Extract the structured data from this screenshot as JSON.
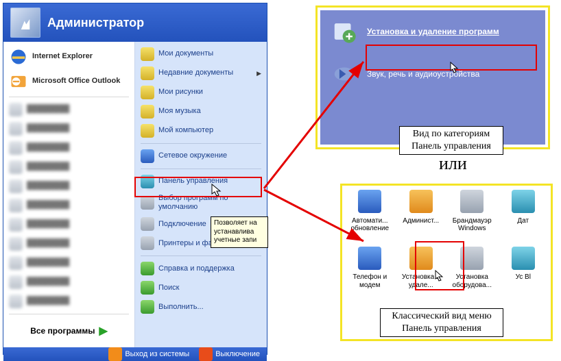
{
  "header": {
    "user": "Администратор"
  },
  "pinned": [
    {
      "label": "Internet Explorer"
    },
    {
      "label": "Microsoft Office Outlook"
    }
  ],
  "recent_blurred_count": 11,
  "all_programs": "Все программы",
  "right_items": [
    {
      "label": "Мои документы",
      "arrow": false
    },
    {
      "label": "Недавние документы",
      "arrow": true
    },
    {
      "label": "Мои рисунки",
      "arrow": false
    },
    {
      "label": "Моя музыка",
      "arrow": false
    },
    {
      "label": "Мой компьютер",
      "arrow": false
    }
  ],
  "right_items2": [
    {
      "label": "Сетевое окружение"
    }
  ],
  "control_panel": "Панель управления",
  "right_items3": [
    {
      "label": "Выбор программ по умолчанию"
    },
    {
      "label": "Подключение",
      "arrow": true
    },
    {
      "label": "Принтеры и факсы"
    }
  ],
  "right_items4": [
    {
      "label": "Справка и поддержка"
    },
    {
      "label": "Поиск"
    },
    {
      "label": "Выполнить..."
    }
  ],
  "footer": {
    "logoff": "Выход из системы",
    "shutdown": "Выключение"
  },
  "tooltip": "Позволяет на устанавлива учетные запи",
  "category_view": {
    "items": [
      {
        "label": "Установка и удаление программ"
      },
      {
        "label": "Звук, речь и аудиоустройства"
      }
    ],
    "caption_line1": "Вид по категориям",
    "caption_line2": "Панель управления"
  },
  "middle_word": "или",
  "classic_view": {
    "row1": [
      {
        "label": "Автомати... обновление"
      },
      {
        "label": "Админист..."
      },
      {
        "label": "Брандмауэр Windows"
      },
      {
        "label": "Дат"
      }
    ],
    "row2": [
      {
        "label": "Телефон и модем"
      },
      {
        "label": "Установка и удале..."
      },
      {
        "label": "Установка оборудова..."
      },
      {
        "label": "Ус Bl"
      }
    ],
    "caption_line1": "Классический вид меню",
    "caption_line2": "Панель управления"
  }
}
